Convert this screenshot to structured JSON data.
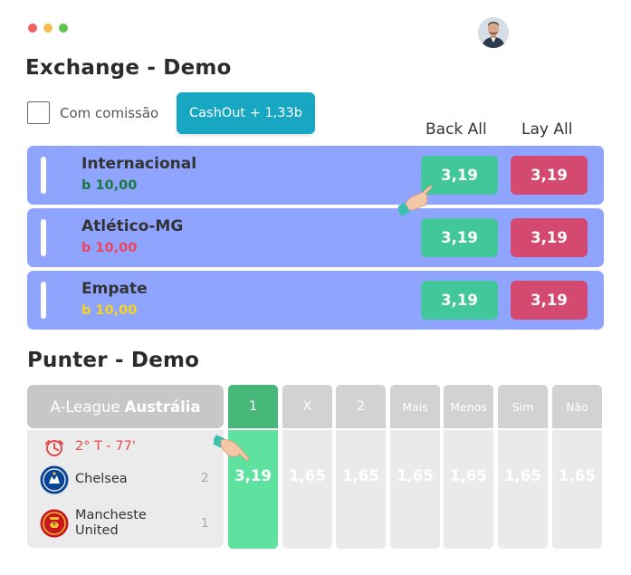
{
  "exchange": {
    "title": "Exchange - Demo",
    "commission_label": "Com comissão",
    "cashout_label": "CashOut + 1,33b",
    "back_all_label": "Back All",
    "lay_all_label": "Lay All",
    "rows": [
      {
        "name": "Internacional",
        "stake": "b 10,00",
        "stake_color": "#1a7a3c",
        "back": "3,19",
        "lay": "3,19"
      },
      {
        "name": "Atlético-MG",
        "stake": "b 10,00",
        "stake_color": "#f0455f",
        "back": "3,19",
        "lay": "3,19"
      },
      {
        "name": "Empate",
        "stake": "b 10,00",
        "stake_color": "#f5d419",
        "back": "3,19",
        "lay": "3,19"
      }
    ]
  },
  "punter": {
    "title": "Punter - Demo",
    "league_prefix": "A-League",
    "league_name": "Austrália",
    "match_time": "2° T - 77'",
    "teams": [
      {
        "name": "Chelsea",
        "score": "2"
      },
      {
        "name": "Manchester United",
        "name_line1": "Mancheste",
        "name_line2": "United",
        "score": "1"
      }
    ],
    "markets": [
      {
        "label": "1",
        "odd": "3,19",
        "active": true
      },
      {
        "label": "X",
        "odd": "1,65",
        "active": false
      },
      {
        "label": "2",
        "odd": "1,65",
        "active": false
      },
      {
        "label": "Mais",
        "odd": "1,65",
        "active": false
      },
      {
        "label": "Menos",
        "odd": "1,65",
        "active": false
      },
      {
        "label": "Sim",
        "odd": "1,65",
        "active": false
      },
      {
        "label": "Não",
        "odd": "1,65",
        "active": false
      }
    ]
  },
  "colors": {
    "row_bg": "#8ea4ff",
    "back_btn": "#42c79b",
    "lay_btn": "#d4496f",
    "cashout": "#17a7c3",
    "active_market": "#5fe2a0"
  }
}
